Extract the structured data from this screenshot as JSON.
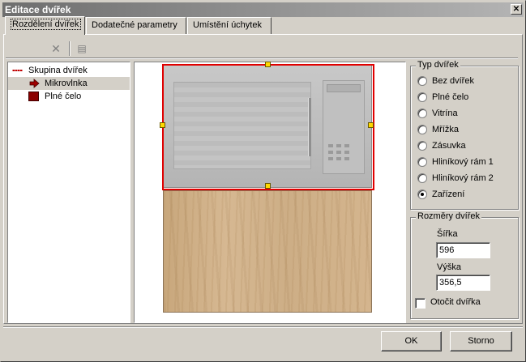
{
  "window": {
    "title": "Editace dvířek",
    "close_glyph": "✕"
  },
  "tabs": [
    {
      "label": "Rozdělení dvířek",
      "active": true
    },
    {
      "label": "Dodatečné parametry",
      "active": false
    },
    {
      "label": "Umístění úchytek",
      "active": false
    }
  ],
  "toolbar": {
    "delete_icon": "delete-x-icon",
    "delete_glyph": "✕",
    "properties_icon": "properties-icon",
    "properties_glyph": "▤"
  },
  "tree": {
    "items": [
      {
        "label": "Skupina dvířek",
        "icon": "door-group-icon",
        "selected": false
      },
      {
        "label": "Mikrovlnka",
        "icon": "arrow-right-icon",
        "selected": true
      },
      {
        "label": "Plné čelo",
        "icon": "solid-front-swatch-icon",
        "selected": false
      }
    ]
  },
  "preview": {
    "selection_color": "#e00000",
    "handle_color": "#ffd800"
  },
  "door_type": {
    "legend": "Typ dvířek",
    "options": [
      {
        "label": "Bez dvířek",
        "checked": false
      },
      {
        "label": "Plné čelo",
        "checked": false
      },
      {
        "label": "Vitrína",
        "checked": false
      },
      {
        "label": "Mřížka",
        "checked": false
      },
      {
        "label": "Zásuvka",
        "checked": false
      },
      {
        "label": "Hliníkový rám 1",
        "checked": false
      },
      {
        "label": "Hliníkový rám 2",
        "checked": false
      },
      {
        "label": "Zařízení",
        "checked": true
      }
    ]
  },
  "dimensions": {
    "legend": "Rozměry dvířek",
    "width_label": "Šířka",
    "width_value": "596",
    "height_label": "Výška",
    "height_value": "356,5",
    "rotate_label": "Otočit dvířka",
    "rotate_checked": false
  },
  "buttons": {
    "ok": "OK",
    "cancel": "Storno"
  }
}
